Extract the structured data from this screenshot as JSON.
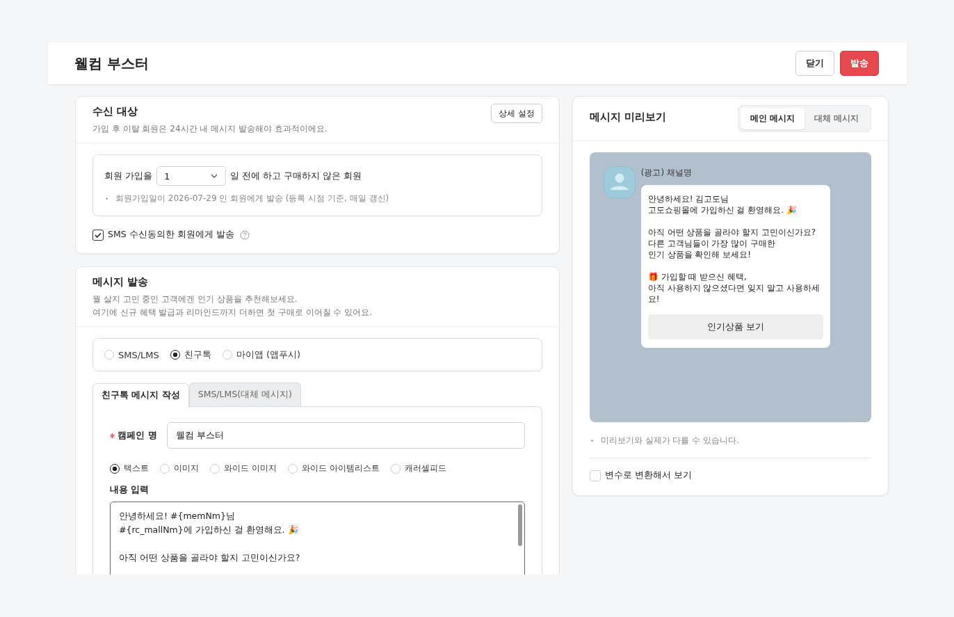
{
  "header": {
    "title": "웰컴 부스터",
    "buttons": [
      {
        "label": "닫기",
        "kind": "secondary"
      },
      {
        "label": "발송",
        "kind": "primary"
      }
    ]
  },
  "recipients": {
    "title": "수신 대상",
    "subtitle": "가입 후 이탈 회원은 24시간 내 메시지 발송해야 효과적이에요.",
    "detail_button": "상세 설정",
    "condition": {
      "prefix": "회원 가입을",
      "select_value": "1",
      "suffix": "일 전에 하고 구매하지 않은 회원",
      "note": "회원가입일이 2026-07-29 인 회원에게 발송 (등록 시점 기준, 매일 갱신)"
    },
    "sms_consent": {
      "label": "SMS 수신동의한 회원에게 발송",
      "checked": true
    }
  },
  "message": {
    "title": "메시지 발송",
    "description": [
      "뭘 살지 고민 중인 고객에겐 인기 상품을 추천해보세요.",
      "여기에 신규 혜택 발급과 리마인드까지 더하면 첫 구매로 이어질 수 있어요."
    ],
    "channels": [
      {
        "label": "SMS/LMS",
        "selected": false
      },
      {
        "label": "친구톡",
        "selected": true
      },
      {
        "label": "마이앱 (앱푸시)",
        "selected": false
      }
    ],
    "tabs": [
      {
        "label": "친구톡 메시지 작성",
        "selected": true
      },
      {
        "label": "SMS/LMS(대체 메시지)",
        "selected": false
      }
    ],
    "campaign_name": {
      "label": "캠페인 명",
      "required": true,
      "value": "웰컴 부스터"
    },
    "content_types": [
      {
        "label": "텍스트",
        "selected": true
      },
      {
        "label": "이미지",
        "selected": false
      },
      {
        "label": "와이드 이미지",
        "selected": false
      },
      {
        "label": "와이드 아이템리스트",
        "selected": false
      },
      {
        "label": "캐러셀피드",
        "selected": false
      }
    ],
    "content": {
      "label": "내용 입력",
      "value": "안녕하세요! #{memNm}님\n#{rc_mallNm}에 가입하신 걸 환영해요. 🎉\n\n아직 어떤 상품을 골라야 할지 고민이신가요?"
    }
  },
  "preview": {
    "title": "메시지 미리보기",
    "tabs": [
      {
        "label": "메인 메시지",
        "selected": true
      },
      {
        "label": "대체 메시지",
        "selected": false
      }
    ],
    "sender": "(광고) 채널명",
    "bubble_text": "안녕하세요! 김고도님\n고도쇼핑몰에 가입하신 걸 환영해요. 🎉\n\n아직 어떤 상품을 골라야 할지 고민이신가요?\n다른 고객님들이 가장 많이 구매한\n인기 상품을 확인해 보세요!\n\n🎁 가입할 때 받으신 혜택,\n아직 사용하지 않으셨다면 잊지 말고 사용하세요!",
    "bubble_button": "인기상품 보기",
    "note": "미리보기와 실제가 다를 수 있습니다.",
    "convert": {
      "label": "변수로 변환해서 보기",
      "checked": false
    }
  }
}
